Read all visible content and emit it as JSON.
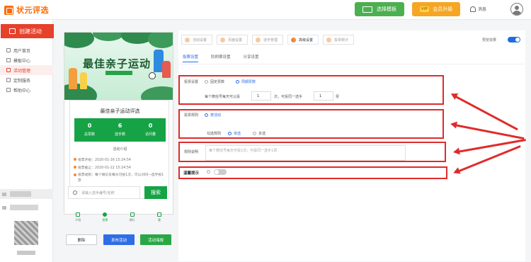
{
  "header": {
    "logo_text": "状元评选",
    "template_btn": "选择模板",
    "vip_badge": "VIP",
    "vip_btn": "会员升级",
    "message": "消息"
  },
  "sidebar": {
    "create_btn": "创建活动",
    "items": [
      {
        "label": "用户首页"
      },
      {
        "label": "模板中心"
      },
      {
        "label": "活动管理"
      },
      {
        "label": "定制服务"
      },
      {
        "label": "帮助中心"
      }
    ]
  },
  "preview": {
    "banner_title": "最佳亲子运动",
    "card_title": "最佳亲子运动评选",
    "stats": [
      {
        "value": "0",
        "label": "总票数"
      },
      {
        "value": "6",
        "label": "选手数"
      },
      {
        "value": "0",
        "label": "访问量"
      }
    ],
    "intro_link": "活动介绍",
    "info_lines": [
      "投票开始：2020-01-16 15:24:54",
      "投票截止：2020-01-22 15:24:54",
      "投票规则：每个微信号每天可投1次，可以对同一选手投1票"
    ],
    "search_placeholder": "请输入选手编号/名称",
    "search_btn": "搜索",
    "tabbar": [
      "介绍",
      "投票",
      "排行",
      "我"
    ],
    "buttons": {
      "delete": "删除",
      "publish": "发布活动",
      "poster": "活动海报"
    }
  },
  "settings": {
    "steps": [
      "活动设置",
      "页面设置",
      "选手管理",
      "高级设置",
      "投票统计"
    ],
    "active_step": 3,
    "preview_label": "预览效果",
    "subtabs": [
      "投票设置",
      "防刷票设置",
      "分享设置"
    ],
    "vote_setting": {
      "label": "投票设置",
      "options": [
        "固定票数",
        "周期票数"
      ],
      "line_prefix": "每个微信号每天可以投",
      "count1": "1",
      "mid": "次，可投同一选手",
      "count2": "1",
      "suffix": "票"
    },
    "vote_rule": {
      "label": "投票规则",
      "option": "按活动",
      "choose_label": "勾选规则",
      "choices": [
        "单选",
        "多选"
      ]
    },
    "rule_desc": {
      "label": "规则说明",
      "placeholder": "每个微信号每天可投1次，可投同一选手1票"
    },
    "warm_tip": {
      "label": "温馨提示"
    }
  }
}
